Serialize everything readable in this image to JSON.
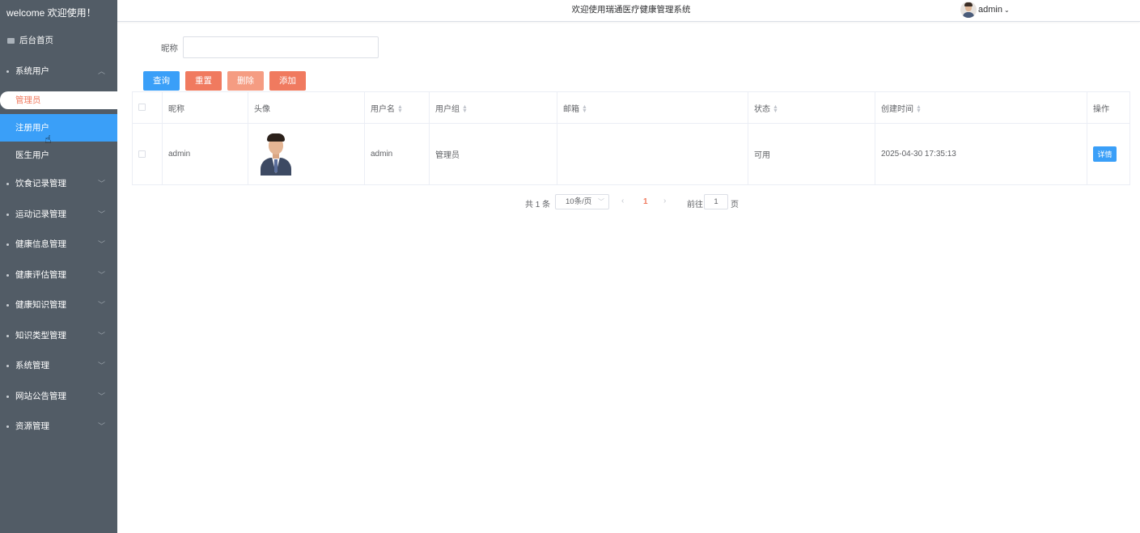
{
  "sidebar": {
    "welcome": "welcome 欢迎使用！",
    "home": "后台首页",
    "system_users": "系统用户",
    "sub_items": [
      "管理员",
      "注册用户",
      "医生用户"
    ],
    "groups": [
      "饮食记录管理",
      "运动记录管理",
      "健康信息管理",
      "健康评估管理",
      "健康知识管理",
      "知识类型管理",
      "系统管理",
      "网站公告管理",
      "资源管理"
    ]
  },
  "header": {
    "title": "欢迎使用瑞通医疗健康管理系统",
    "user": "admin"
  },
  "search": {
    "label": "昵称",
    "value": "",
    "placeholder": ""
  },
  "toolbar": {
    "query": "查询",
    "reset": "重置",
    "delete": "删除",
    "add": "添加"
  },
  "table": {
    "columns": [
      "昵称",
      "头像",
      "用户名",
      "用户组",
      "邮箱",
      "状态",
      "创建时间",
      "操作"
    ],
    "rows": [
      {
        "nickname": "admin",
        "username": "admin",
        "group": "管理员",
        "email": "",
        "status": "可用",
        "created": "2025-04-30 17:35:13",
        "action": "详情"
      }
    ]
  },
  "pager": {
    "total": "共 1 条",
    "size": "10条/页",
    "current": "1",
    "goto": "前往",
    "jump_value": "1",
    "unit": "页"
  },
  "colors": {
    "sidebar_bg": "#525c66",
    "primary": "#3a9ff8",
    "danger": "#f07a5f"
  }
}
